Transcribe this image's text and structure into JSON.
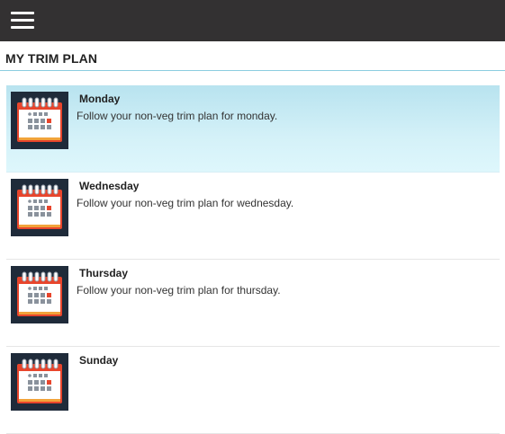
{
  "topbar": {
    "menu_icon": "hamburger-menu-icon",
    "background": "#333132"
  },
  "page": {
    "title": "MY TRIM PLAN"
  },
  "plans": [
    {
      "day": "Monday",
      "description": "Follow your non-veg trim plan for monday.",
      "selected": true,
      "icon": "calendar-icon"
    },
    {
      "day": "Wednesday",
      "description": "Follow your non-veg trim plan for wednesday.",
      "selected": false,
      "icon": "calendar-icon"
    },
    {
      "day": "Thursday",
      "description": "Follow your non-veg trim plan for thursday.",
      "selected": false,
      "icon": "calendar-icon"
    },
    {
      "day": "Sunday",
      "description": "",
      "selected": false,
      "icon": "calendar-icon"
    }
  ],
  "colors": {
    "accent_rule": "#8ccde0",
    "selected_row": "#c8ecf5",
    "calendar_bg": "#1f2b3a",
    "calendar_red": "#e8452c",
    "calendar_orange": "#f2a33a"
  }
}
